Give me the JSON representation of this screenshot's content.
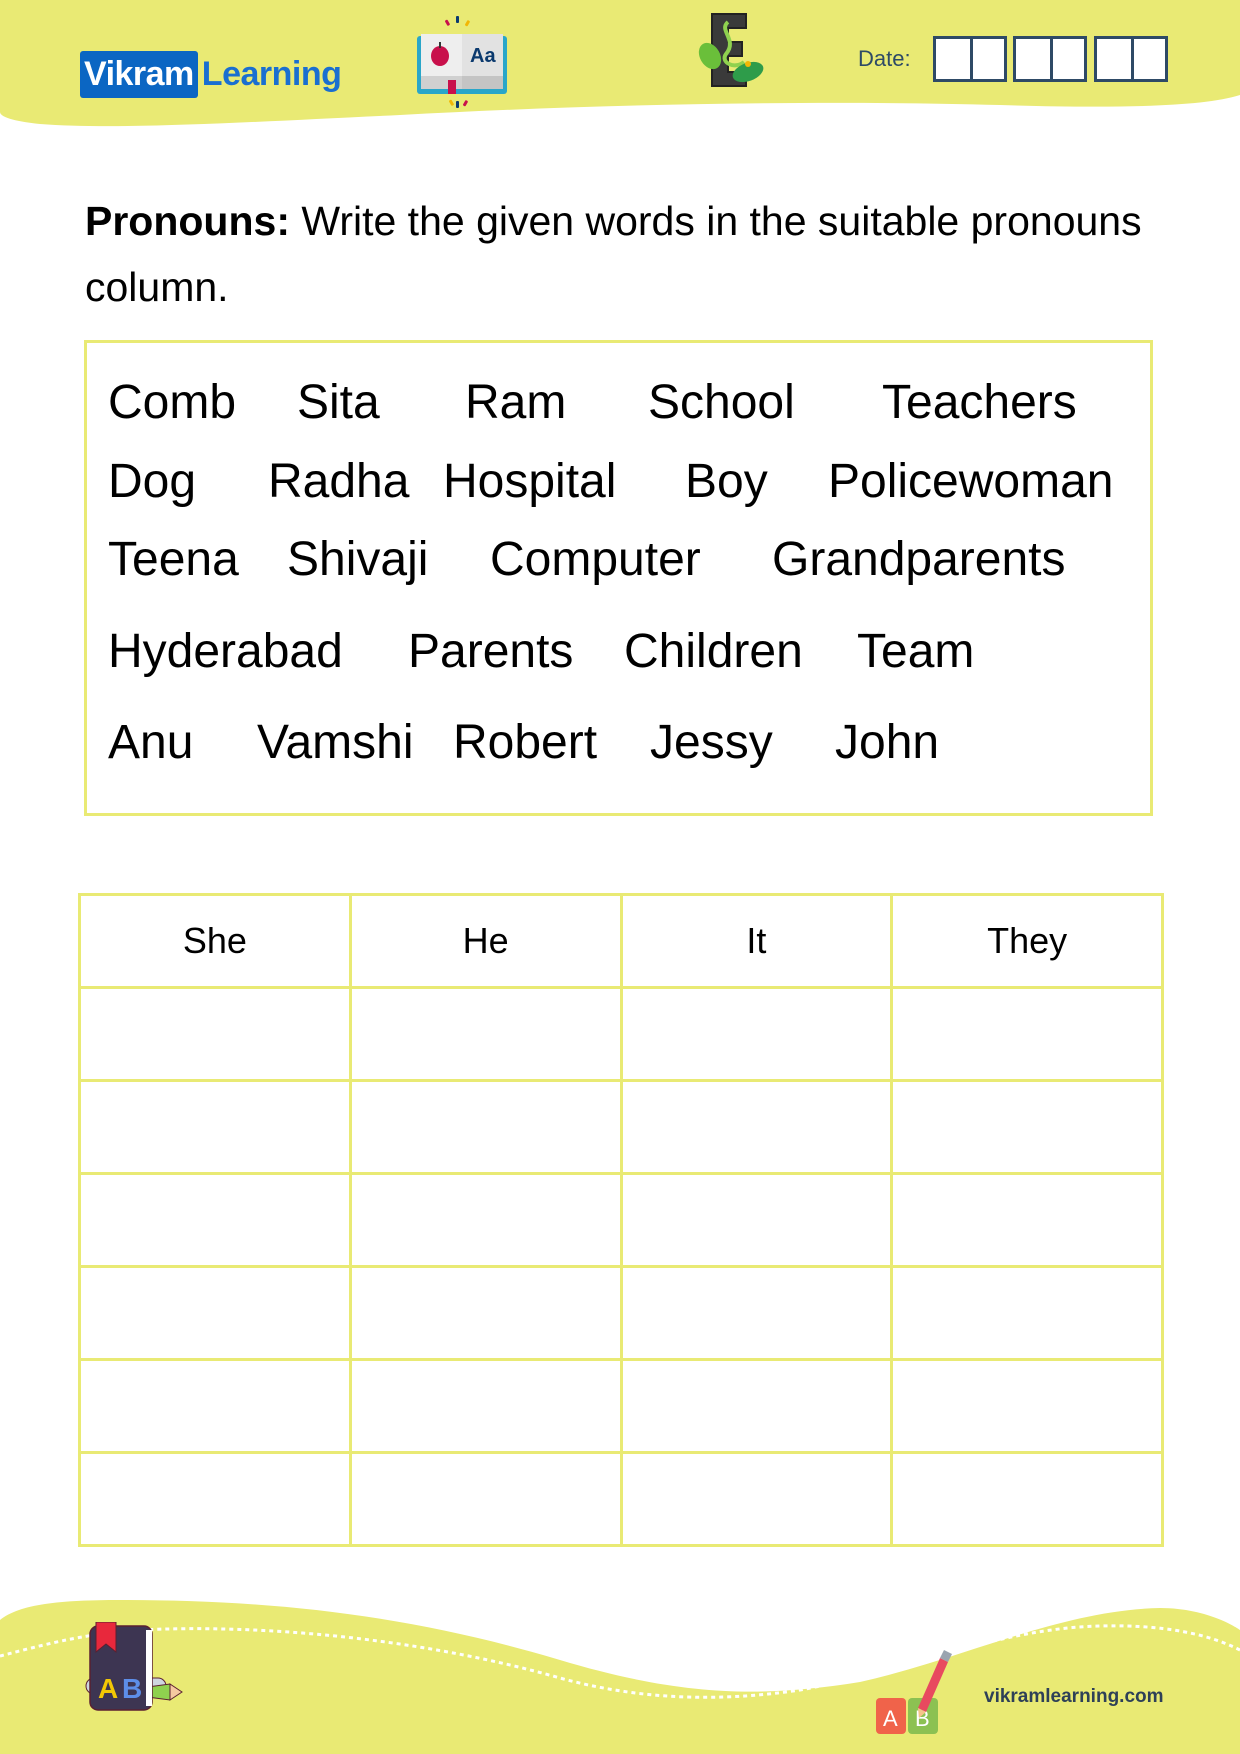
{
  "header": {
    "brand_primary": "Vikram",
    "brand_secondary": "Learning",
    "date_label": "Date:",
    "date_fields": [
      {
        "name": "day",
        "digits": 2
      },
      {
        "name": "month",
        "digits": 2
      },
      {
        "name": "year",
        "digits": 2
      }
    ],
    "icons": [
      "open-book-icon",
      "letter-e-leaf-icon"
    ]
  },
  "colors": {
    "accent_yellow": "#e9ea74",
    "brand_blue": "#0b66c3",
    "date_box_border": "#2e4a66",
    "website_text": "#2e4057"
  },
  "instruction": {
    "label": "Pronouns:",
    "text": " Write the given words in the suitable pronouns column."
  },
  "word_bank": {
    "rows": [
      [
        "Comb",
        "Sita",
        "Ram",
        "School",
        "Teachers"
      ],
      [
        "Dog",
        "Radha",
        "Hospital",
        "Boy",
        "Policewoman"
      ],
      [
        "Teena",
        "Shivaji",
        "Computer",
        "Grandparents"
      ],
      [
        "Hyderabad",
        "Parents",
        "Children",
        "Team"
      ],
      [
        "Anu",
        "Vamshi",
        "Robert",
        "Jessy",
        "John"
      ]
    ]
  },
  "pronoun_table": {
    "headers": [
      "She",
      "He",
      "It",
      "They"
    ],
    "blank_rows": 6
  },
  "footer": {
    "website": "vikramlearning.com",
    "icons": [
      "ab-book-pencil-icon",
      "ab-blocks-pencil-icon"
    ]
  }
}
